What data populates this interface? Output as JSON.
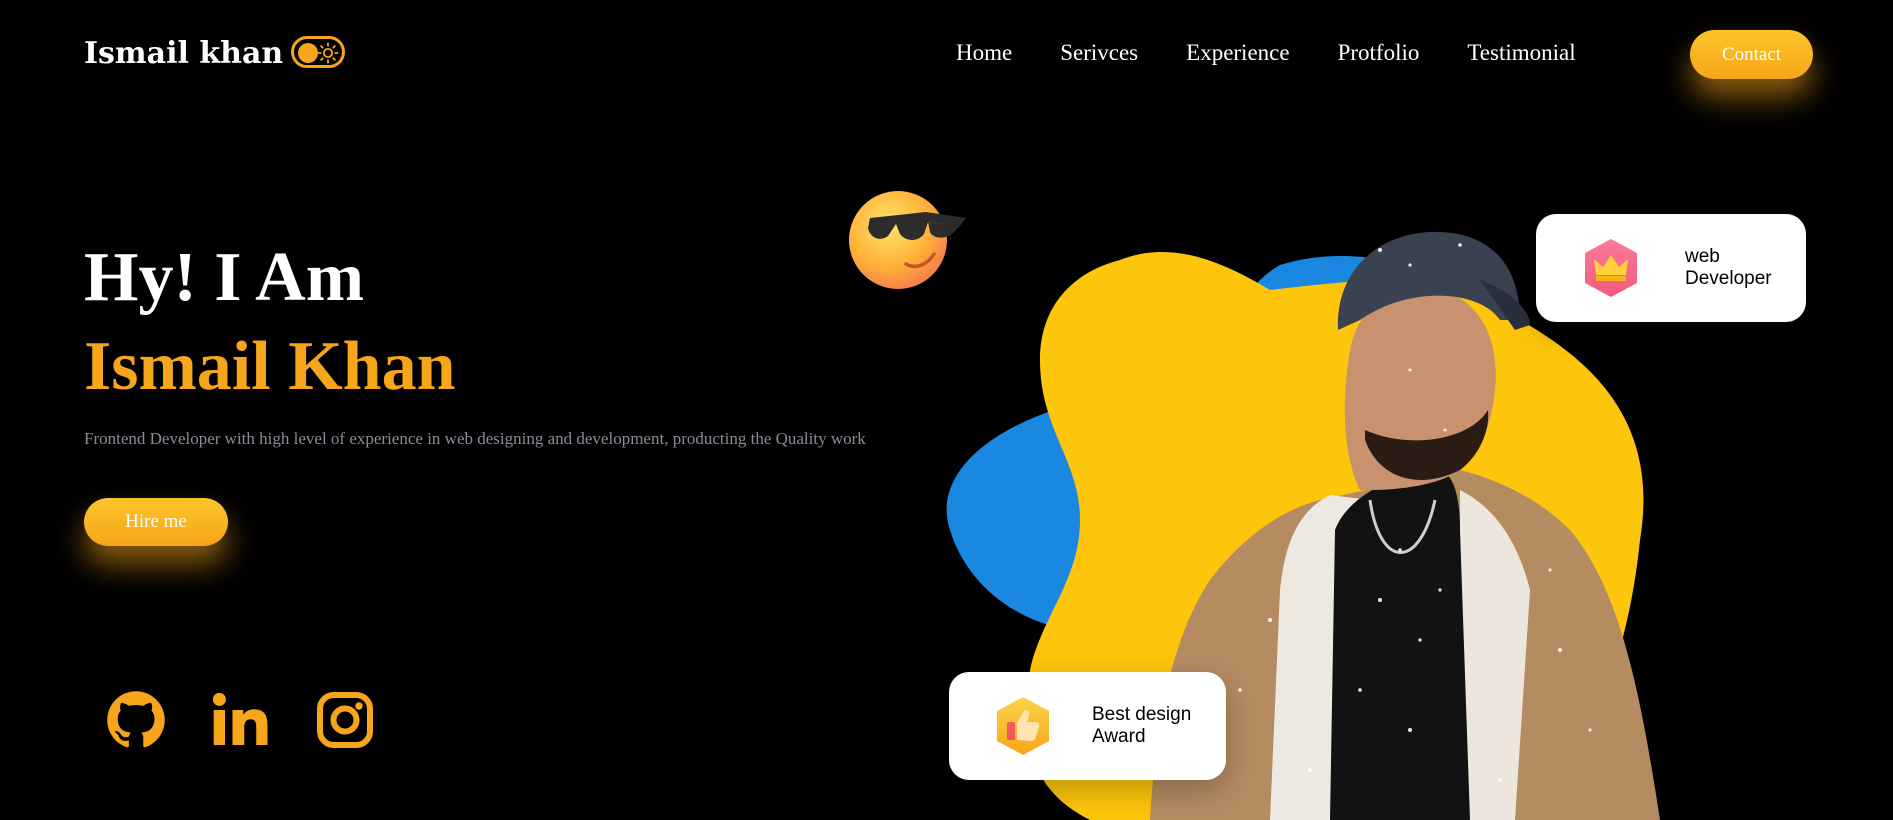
{
  "brand": {
    "name": "Ismail khan"
  },
  "theme_toggle": {
    "state": "dark",
    "icon": "sun-icon"
  },
  "nav": {
    "items": [
      "Home",
      "Serivces",
      "Experience",
      "Protfolio",
      "Testimonial"
    ],
    "contact_label": "Contact"
  },
  "hero": {
    "greeting": "Hy! I Am",
    "name": "Ismail Khan",
    "description": "Frontend Developer with high level of experience in web designing and development, producting the Quality work",
    "cta_label": "Hire me"
  },
  "social": [
    "github-icon",
    "linkedin-icon",
    "instagram-icon"
  ],
  "cards": {
    "role": {
      "line1": "web",
      "line2": "Developer",
      "icon": "crown-icon"
    },
    "award": {
      "line1": "Best design",
      "line2": "Award",
      "icon": "thumbs-up-icon"
    }
  },
  "colors": {
    "accent": "#f7a51a",
    "accent_light": "#fcc52a",
    "blob_yellow": "#fdc50b",
    "blob_blue": "#1a88e0",
    "background": "#000000",
    "muted_text": "#8a8a9a"
  }
}
